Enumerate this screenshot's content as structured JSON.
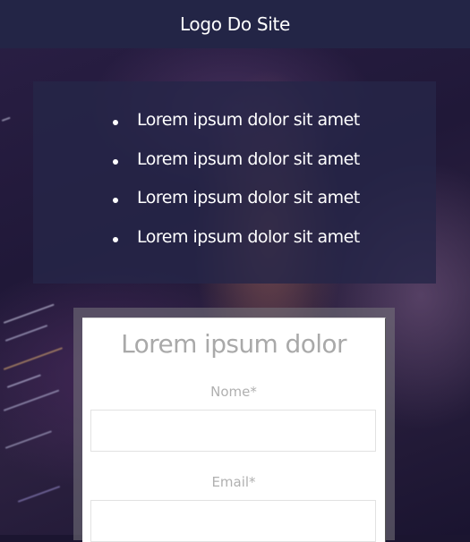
{
  "header": {
    "logo_text": "Logo Do Site"
  },
  "features": {
    "items": [
      {
        "label": "Lorem ipsum dolor sit amet"
      },
      {
        "label": "Lorem ipsum dolor sit amet"
      },
      {
        "label": "Lorem ipsum dolor sit amet"
      },
      {
        "label": "Lorem ipsum dolor sit amet"
      }
    ]
  },
  "form": {
    "title": "Lorem ipsum dolor",
    "fields": [
      {
        "label": "Nome*",
        "value": ""
      },
      {
        "label": "Email*",
        "value": ""
      }
    ]
  },
  "colors": {
    "header_bg": "#232546",
    "panel_bg": "#262648",
    "text_light": "#ffffff",
    "text_muted": "#a9a9a9"
  }
}
